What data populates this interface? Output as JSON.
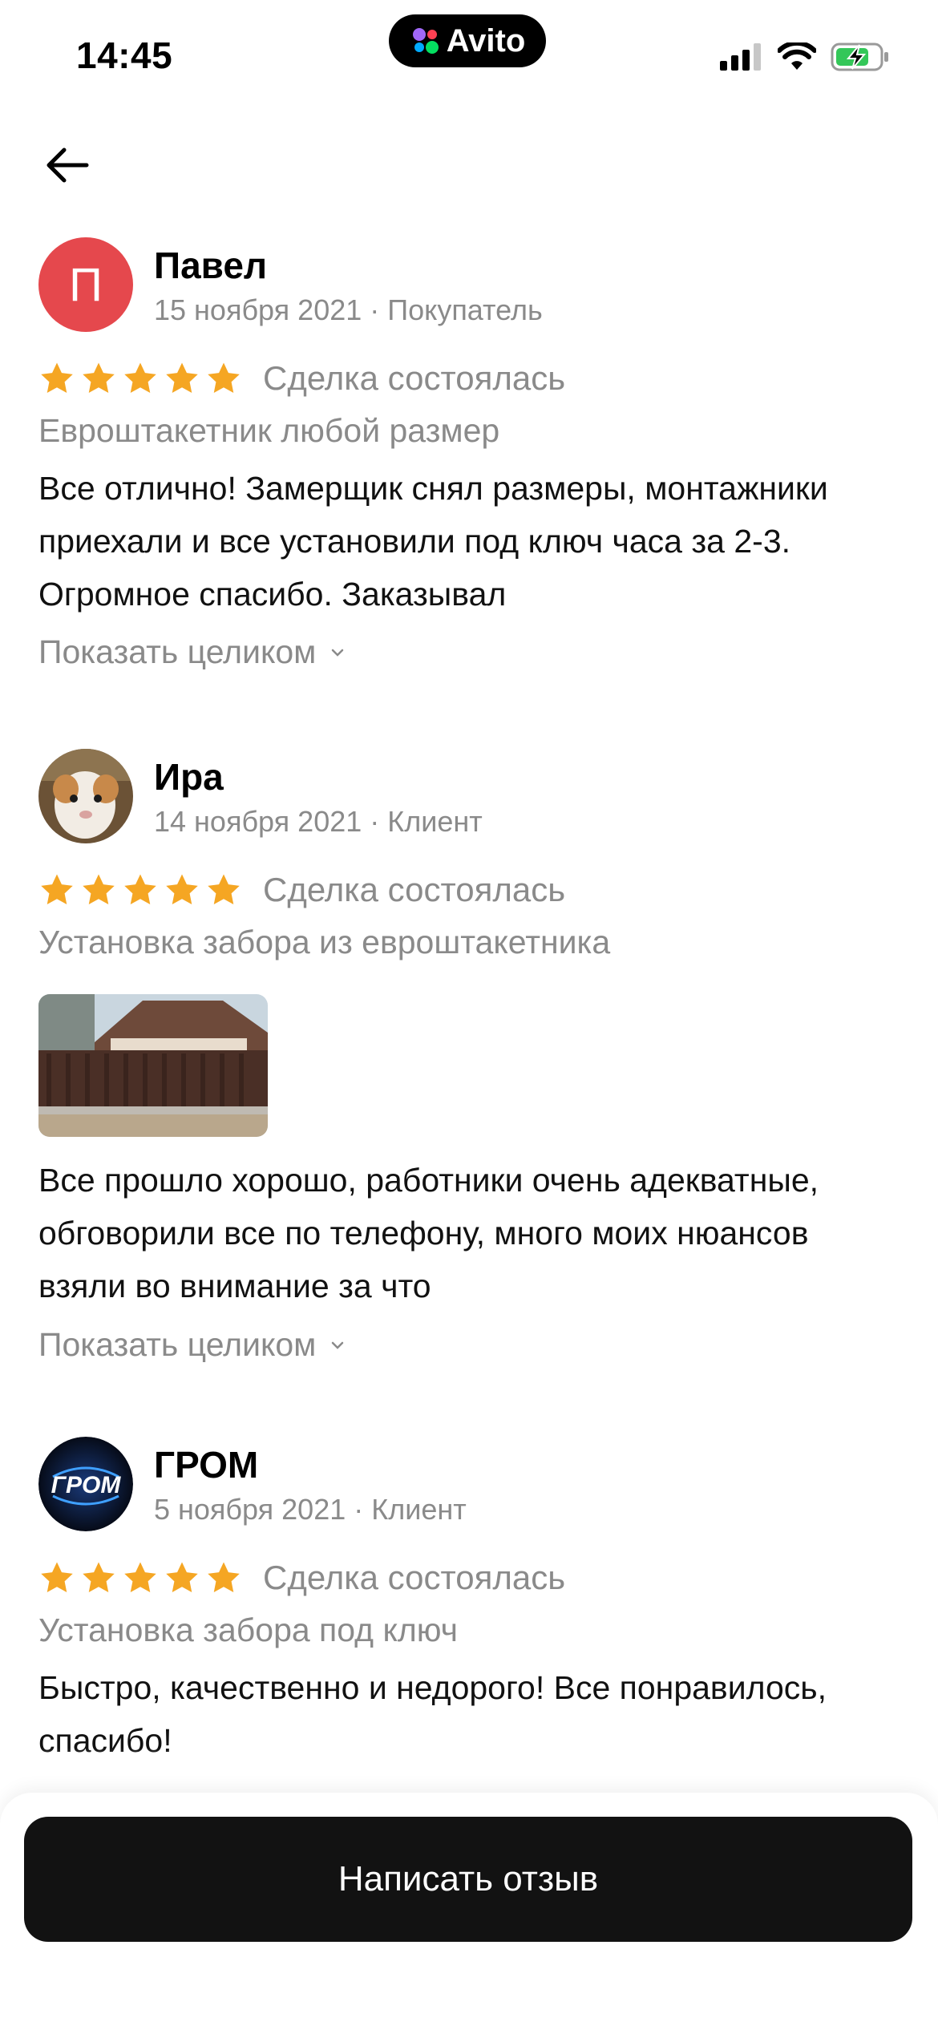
{
  "status_bar": {
    "time": "14:45",
    "app_badge": "Avito"
  },
  "reviews": [
    {
      "avatar_letter": "П",
      "name": "Павел",
      "date": "15 ноября 2021",
      "role": "Покупатель",
      "rating": 5,
      "deal_status": "Сделка состоялась",
      "service": "Евроштакетник любой размер",
      "text": "Все отлично! Замерщик снял размеры, монтажники приехали и все установили под ключ часа за 2-3. Огромное спасибо. Заказывал",
      "show_more": "Показать целиком"
    },
    {
      "name": "Ира",
      "date": "14 ноября 2021",
      "role": "Клиент",
      "rating": 5,
      "deal_status": "Сделка состоялась",
      "service": "Установка забора из евроштакетника",
      "text": "Все прошло хорошо, работники очень адекватные, обговорили все по телефону, много моих нюансов взяли во внимание за что",
      "show_more": "Показать целиком"
    },
    {
      "avatar_logo_text": "ГРОМ",
      "name": "ГРОМ",
      "date": "5 ноября 2021",
      "role": "Клиент",
      "rating": 5,
      "deal_status": "Сделка состоялась",
      "service": "Установка забора под ключ",
      "text": "Быстро, качественно и недорого! Все понравилось, спасибо!"
    }
  ],
  "cta": {
    "label": "Написать отзыв"
  },
  "colors": {
    "star": "#f5a623",
    "avatar_red": "#e5484d",
    "muted_text": "#8a8a8a",
    "button_bg": "#121212"
  }
}
